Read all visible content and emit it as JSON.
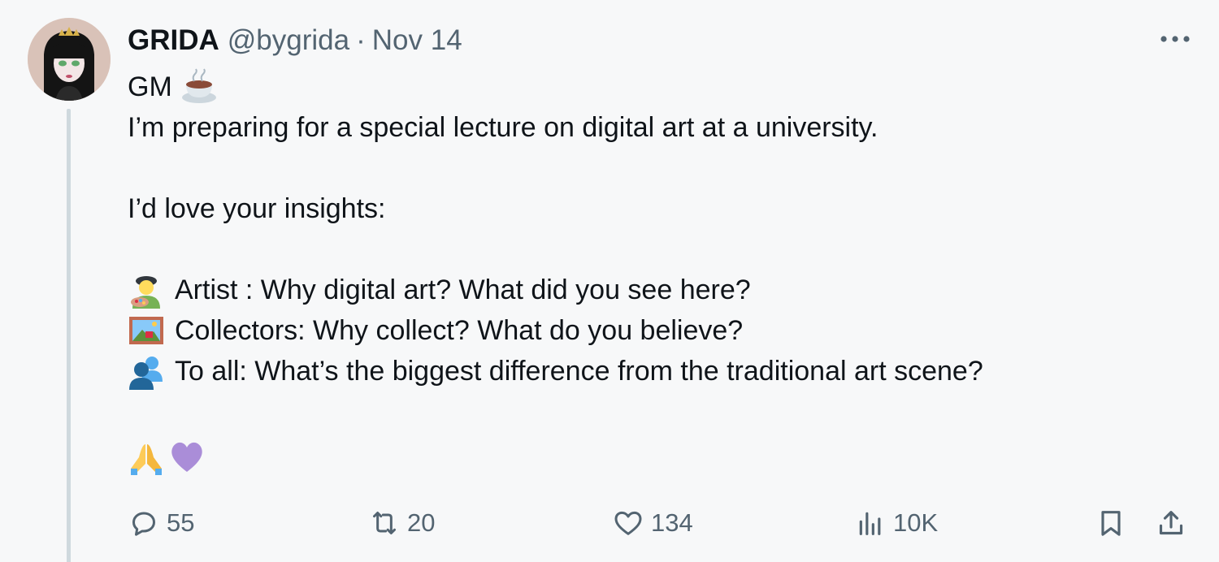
{
  "tweet": {
    "author": {
      "name": "GRIDA",
      "handle": "@bygrida",
      "separator": "·",
      "date": "Nov 14"
    },
    "body": {
      "greeting": "GM",
      "greeting_emoji": "hot-beverage-emoji",
      "intro": "I’m preparing for a special lecture on digital art at a university.",
      "ask": "I’d love your insights:",
      "questions": [
        {
          "emoji": "artist-emoji",
          "text": "Artist : Why digital art? What did you see here?"
        },
        {
          "emoji": "framed-picture-emoji",
          "text": "Collectors: Why collect? What do you believe?"
        },
        {
          "emoji": "busts-in-silhouette-emoji",
          "text": "To all: What’s the biggest difference from the traditional art scene?"
        }
      ],
      "closing_emojis": [
        "folded-hands-emoji",
        "purple-heart-emoji"
      ]
    },
    "actions": {
      "replies": "55",
      "reposts": "20",
      "likes": "134",
      "views": "10K"
    },
    "icons": [
      "more-icon",
      "reply-icon",
      "repost-icon",
      "like-icon",
      "views-icon",
      "bookmark-icon",
      "share-icon"
    ]
  },
  "colors": {
    "background": "#f7f8f9",
    "text": "#0f1419",
    "secondary_text": "#536471",
    "thread_line": "#cfd9de"
  }
}
